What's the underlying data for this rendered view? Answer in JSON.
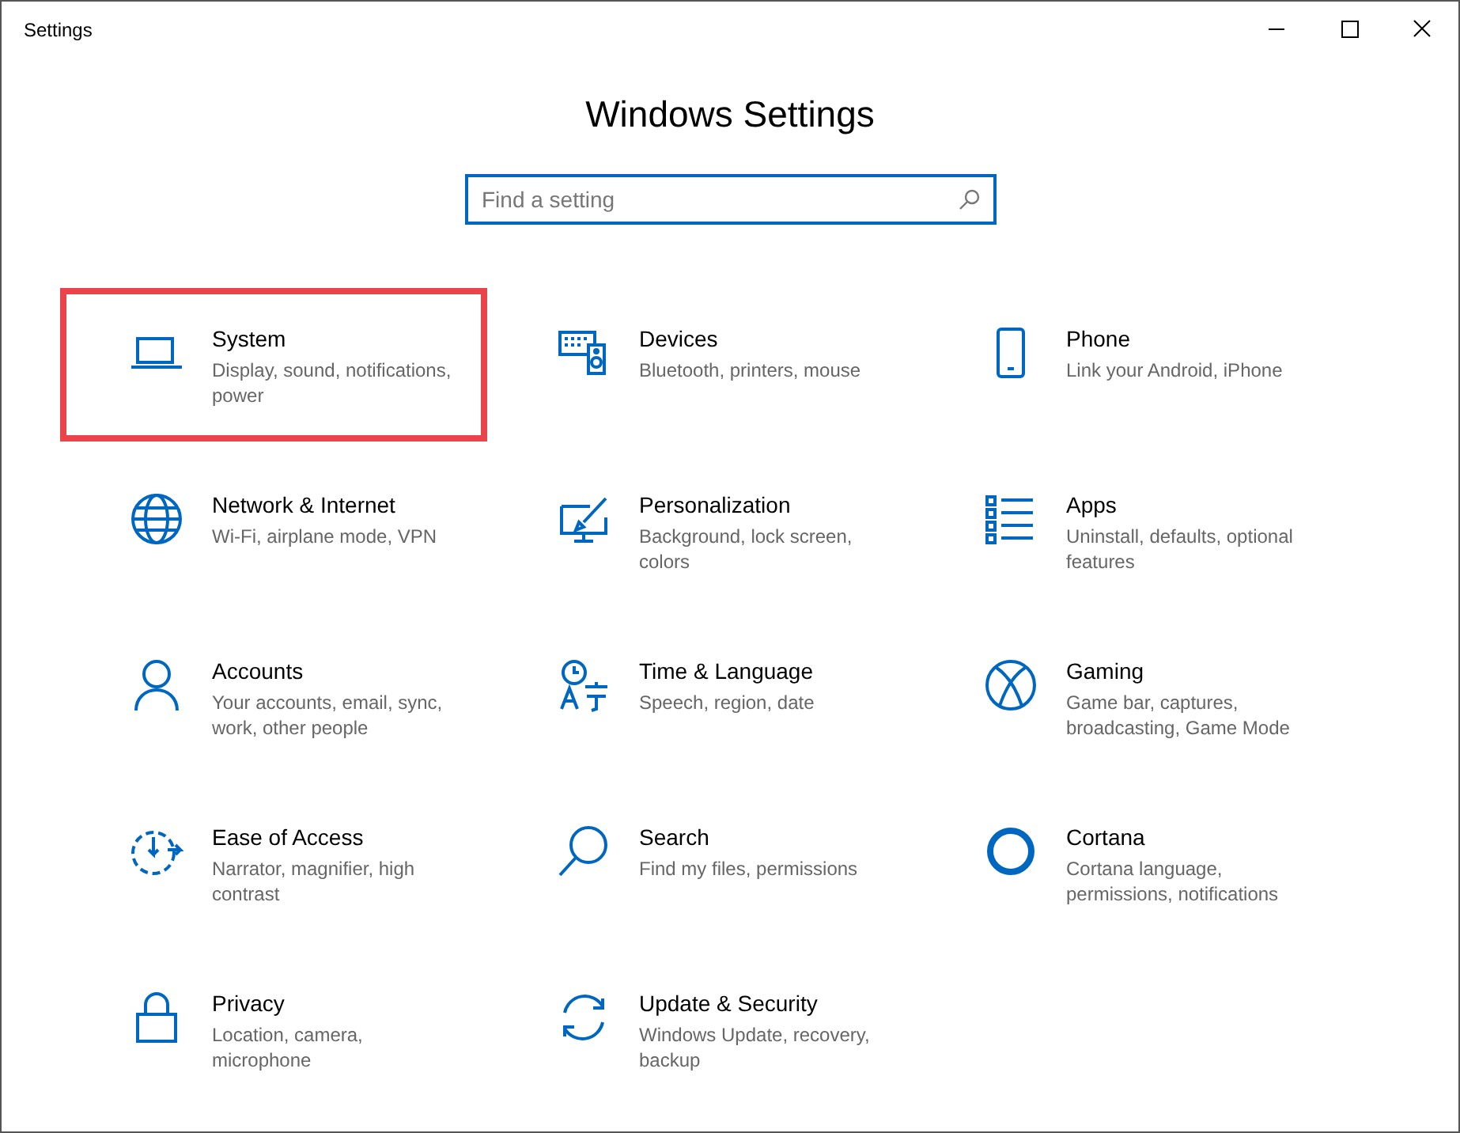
{
  "window": {
    "title": "Settings"
  },
  "heading": "Windows Settings",
  "search": {
    "placeholder": "Find a setting"
  },
  "tiles": [
    {
      "kind": "laptop",
      "title": "System",
      "subtitle": "Display, sound, notifications, power",
      "highlighted": true
    },
    {
      "kind": "devices",
      "title": "Devices",
      "subtitle": "Bluetooth, printers, mouse",
      "highlighted": false
    },
    {
      "kind": "phone",
      "title": "Phone",
      "subtitle": "Link your Android, iPhone",
      "highlighted": false
    },
    {
      "kind": "globe",
      "title": "Network & Internet",
      "subtitle": "Wi-Fi, airplane mode, VPN",
      "highlighted": false
    },
    {
      "kind": "brush",
      "title": "Personalization",
      "subtitle": "Background, lock screen, colors",
      "highlighted": false
    },
    {
      "kind": "list",
      "title": "Apps",
      "subtitle": "Uninstall, defaults, optional features",
      "highlighted": false
    },
    {
      "kind": "person",
      "title": "Accounts",
      "subtitle": "Your accounts, email, sync, work, other people",
      "highlighted": false
    },
    {
      "kind": "clock",
      "title": "Time & Language",
      "subtitle": "Speech, region, date",
      "highlighted": false
    },
    {
      "kind": "xbox",
      "title": "Gaming",
      "subtitle": "Game bar, captures, broadcasting, Game Mode",
      "highlighted": false
    },
    {
      "kind": "ease",
      "title": "Ease of Access",
      "subtitle": "Narrator, magnifier, high contrast",
      "highlighted": false
    },
    {
      "kind": "magnifier",
      "title": "Search",
      "subtitle": "Find my files, permissions",
      "highlighted": false
    },
    {
      "kind": "ring",
      "title": "Cortana",
      "subtitle": "Cortana language, permissions, notifications",
      "highlighted": false
    },
    {
      "kind": "lock",
      "title": "Privacy",
      "subtitle": "Location, camera, microphone",
      "highlighted": false
    },
    {
      "kind": "sync",
      "title": "Update & Security",
      "subtitle": "Windows Update, recovery, backup",
      "highlighted": false
    }
  ]
}
